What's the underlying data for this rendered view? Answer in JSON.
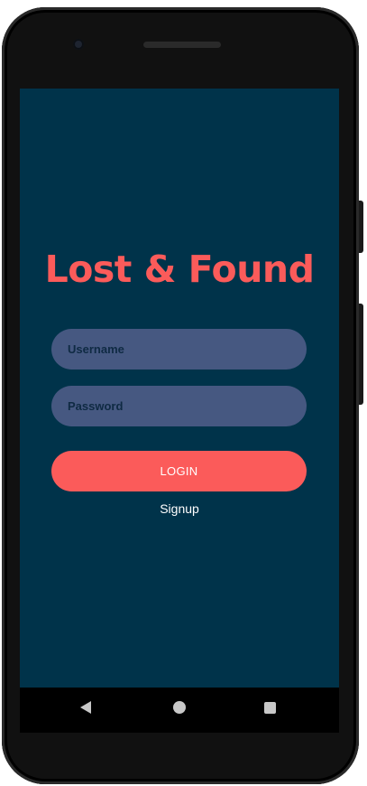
{
  "app": {
    "title": "Lost & Found"
  },
  "form": {
    "username_placeholder": "Username",
    "username_value": "",
    "password_placeholder": "Password",
    "password_value": "",
    "login_label": "LOGIN",
    "signup_label": "Signup"
  },
  "nav": {
    "back_icon": "back-triangle-icon",
    "home_icon": "home-circle-icon",
    "recents_icon": "recents-square-icon"
  },
  "colors": {
    "background": "#00334a",
    "accent": "#fb5b5a",
    "input_background": "#465881",
    "placeholder_text": "#0f2a43",
    "button_text": "#ffffff"
  }
}
